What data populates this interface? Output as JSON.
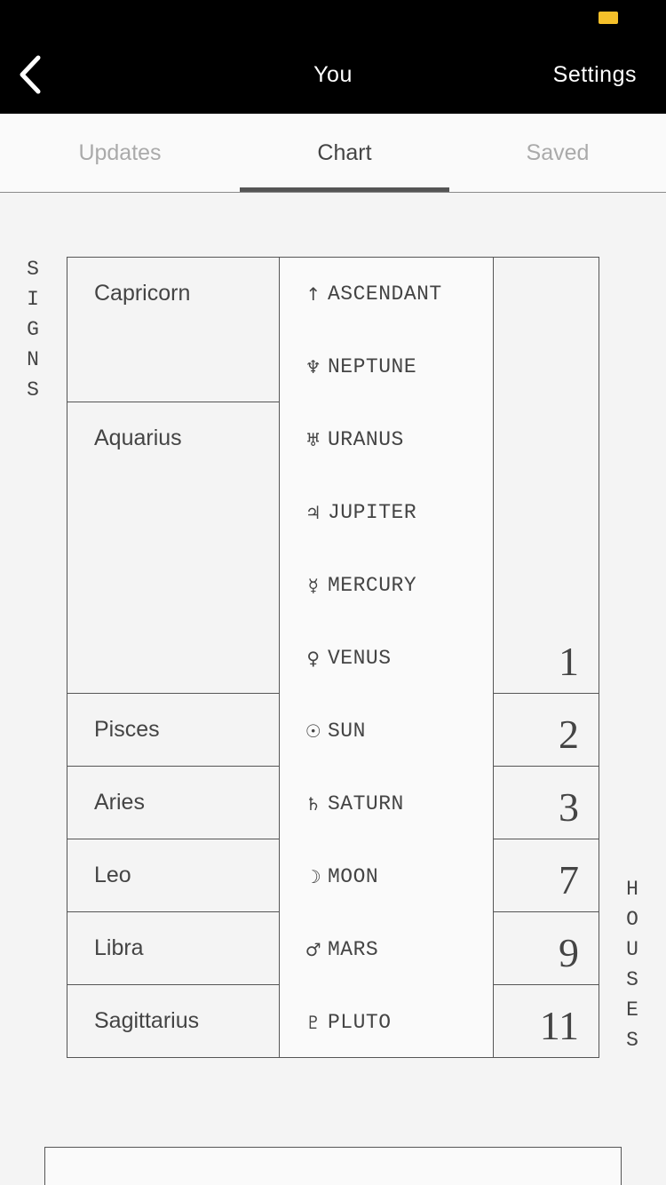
{
  "nav": {
    "title": "You",
    "settings_label": "Settings",
    "back_icon": "chevron-left-icon"
  },
  "tabs": [
    {
      "label": "Updates",
      "active": false
    },
    {
      "label": "Chart",
      "active": true
    },
    {
      "label": "Saved",
      "active": false
    }
  ],
  "side_labels": {
    "signs": [
      "S",
      "I",
      "G",
      "N",
      "S"
    ],
    "houses": [
      "H",
      "O",
      "U",
      "S",
      "E",
      "S"
    ]
  },
  "signs": [
    {
      "label": "Capricorn"
    },
    {
      "label": "Aquarius"
    },
    {
      "label": "Pisces"
    },
    {
      "label": "Aries"
    },
    {
      "label": "Leo"
    },
    {
      "label": "Libra"
    },
    {
      "label": "Sagittarius"
    }
  ],
  "planets": [
    {
      "glyph": "↑",
      "name": "ASCENDANT",
      "icon": "ascendant-icon"
    },
    {
      "glyph": "♆",
      "name": "NEPTUNE",
      "icon": "neptune-icon"
    },
    {
      "glyph": "♅",
      "name": "URANUS",
      "icon": "uranus-icon"
    },
    {
      "glyph": "♃",
      "name": "JUPITER",
      "icon": "jupiter-icon"
    },
    {
      "glyph": "☿",
      "name": "MERCURY",
      "icon": "mercury-icon"
    },
    {
      "glyph": "♀",
      "name": "VENUS",
      "icon": "venus-icon"
    },
    {
      "glyph": "☉",
      "name": "SUN",
      "icon": "sun-icon"
    },
    {
      "glyph": "♄",
      "name": "SATURN",
      "icon": "saturn-icon"
    },
    {
      "glyph": "☽",
      "name": "MOON",
      "icon": "moon-icon"
    },
    {
      "glyph": "♂",
      "name": "MARS",
      "icon": "mars-icon"
    },
    {
      "glyph": "♇",
      "name": "PLUTO",
      "icon": "pluto-icon"
    }
  ],
  "houses": [
    {
      "number": "1"
    },
    {
      "number": "2"
    },
    {
      "number": "3"
    },
    {
      "number": "7"
    },
    {
      "number": "9"
    },
    {
      "number": "11"
    }
  ],
  "colors": {
    "nav_bg": "#000000",
    "battery": "#f5c02a",
    "page_bg": "#f4f4f4"
  }
}
